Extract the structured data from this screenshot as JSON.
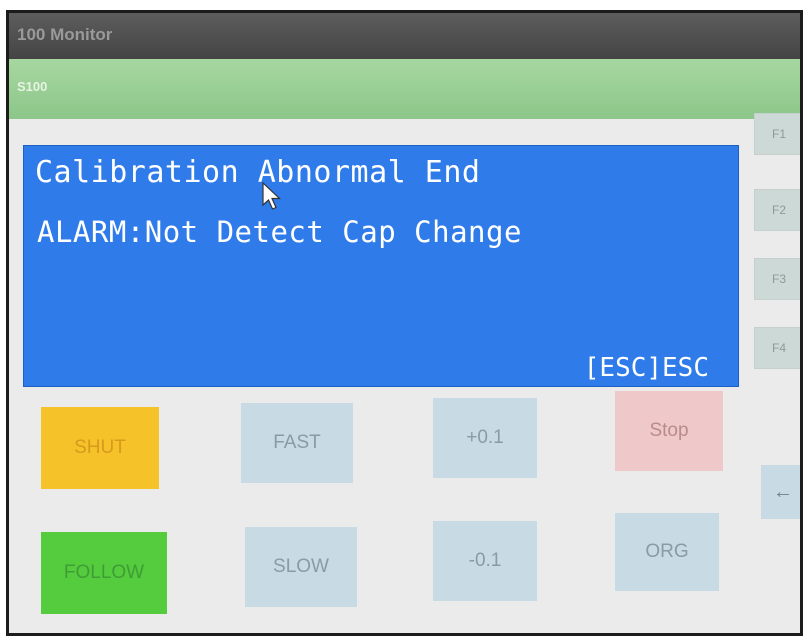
{
  "window": {
    "title": "100 Monitor"
  },
  "header": {
    "label": "S100"
  },
  "message": {
    "line1": "Calibration Abnormal End",
    "line2": "ALARM:Not Detect Cap Change",
    "esc_hint": "[ESC]ESC"
  },
  "function_keys": [
    "F1",
    "F2",
    "F3",
    "F4"
  ],
  "buttons": {
    "shut": "SHUT",
    "fast": "FAST",
    "plus": "+0.1",
    "stop": "Stop",
    "follow": "FOLLOW",
    "slow": "SLOW",
    "minus": "-0.1",
    "org": "ORG",
    "back": "←"
  },
  "colors": {
    "panel": "#2f7bea",
    "shut": "#f5c22a",
    "follow": "#55cc3e",
    "stop": "#efc9c9",
    "neutral": "#c8dbe4"
  }
}
